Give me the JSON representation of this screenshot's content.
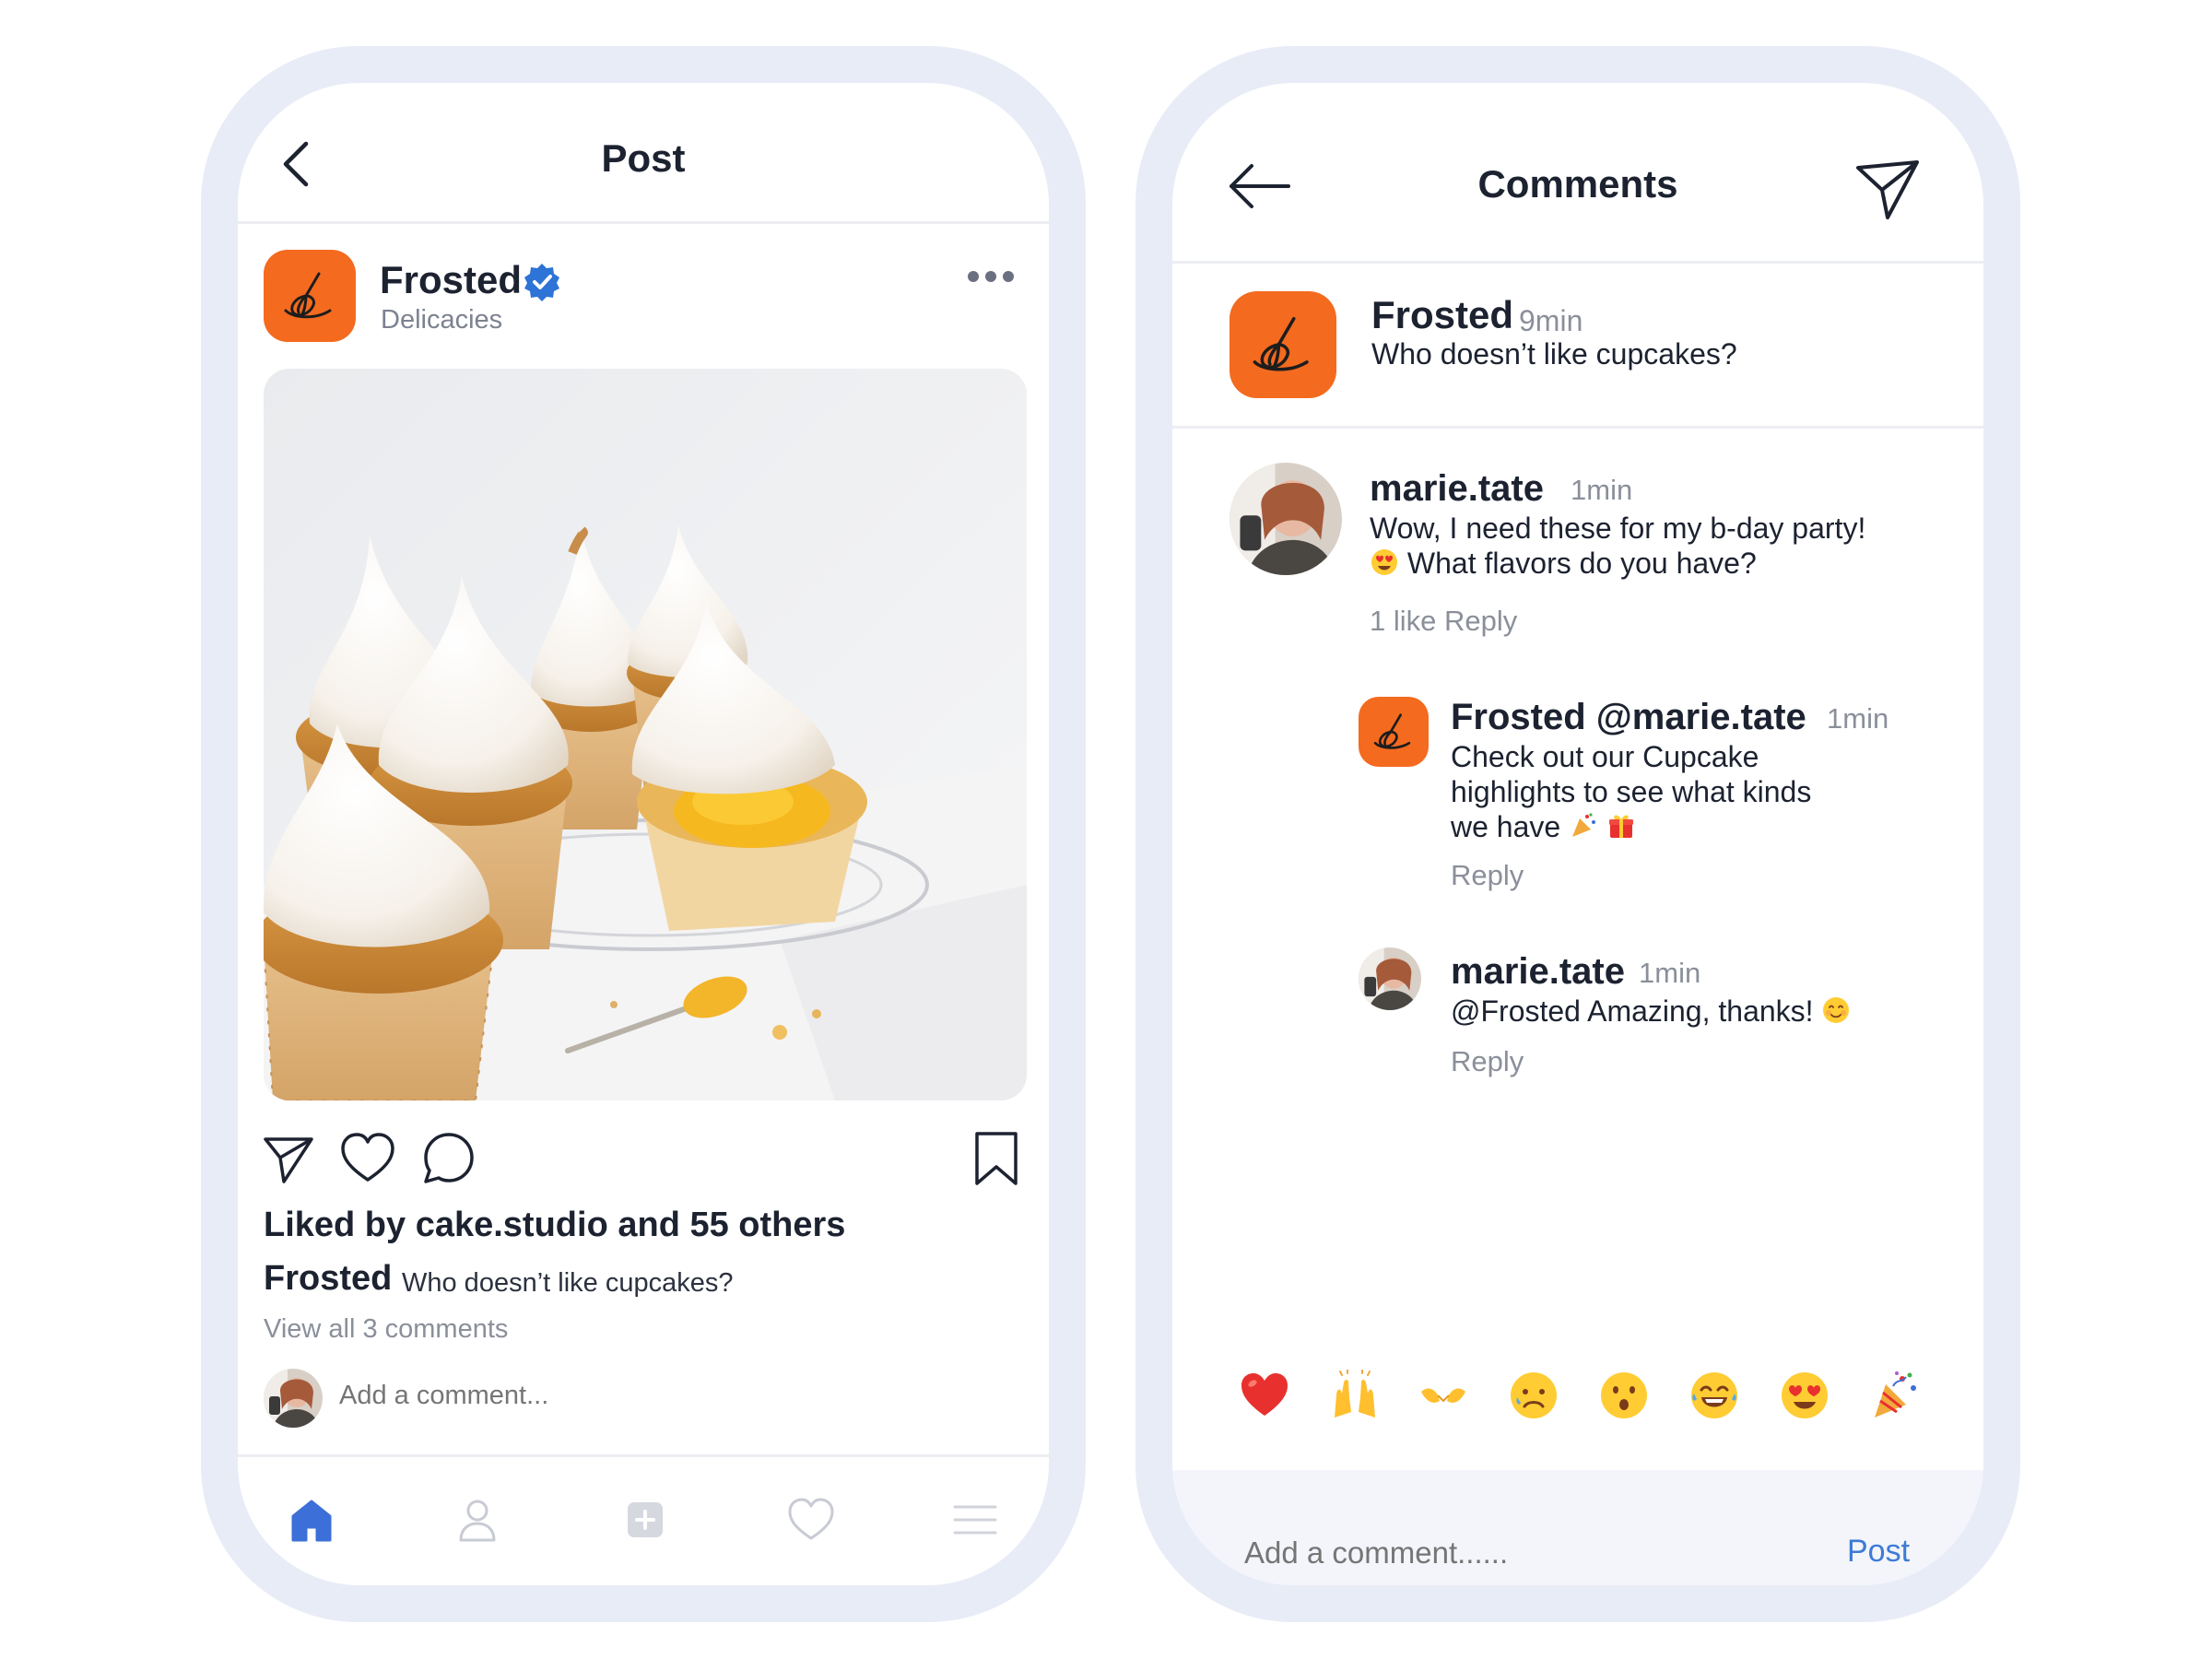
{
  "post_screen": {
    "title": "Post",
    "brand_name": "Frosted",
    "brand_subtitle": "Delicacies",
    "likes_text": "Liked by cake.studio and 55 others",
    "caption_user": "Frosted",
    "caption_text": "Who doesn’t like cupcakes?",
    "view_all_comments": "View all 3 comments",
    "add_comment_placeholder": "Add a comment...",
    "nav_items": [
      "home-icon",
      "profile-icon",
      "add-post-icon",
      "activity-heart-icon",
      "menu-icon"
    ],
    "colors": {
      "accent": "#3c6fd8",
      "brand_orange": "#f46a1f",
      "verified_blue": "#2e73d6"
    }
  },
  "comments_screen": {
    "title": "Comments",
    "post": {
      "user": "Frosted",
      "time": "9min",
      "text": "Who doesn’t like cupcakes?"
    },
    "comments": [
      {
        "user": "marie.tate",
        "time": "1min",
        "line1": "Wow, I need these for my b-day party!",
        "line2": "What flavors do you have?",
        "meta": "1 like Reply"
      },
      {
        "user": "Frosted @marie.tate",
        "time": "1min",
        "line1": "Check out our Cupcake",
        "line2": "highlights to see what kinds",
        "line3": "we have",
        "meta": "Reply"
      },
      {
        "user": "marie.tate",
        "time": "1min",
        "line1": "@Frosted Amazing, thanks!",
        "meta": "Reply"
      }
    ],
    "reactions": [
      "heart",
      "raised-hands",
      "clapping",
      "sad",
      "surprised",
      "laughing",
      "heart-eyes",
      "party-popper"
    ],
    "input_placeholder": "Add a comment......",
    "post_button": "Post",
    "colors": {
      "post_link": "#3c7bd6",
      "input_bg": "#f3f5fb"
    }
  }
}
